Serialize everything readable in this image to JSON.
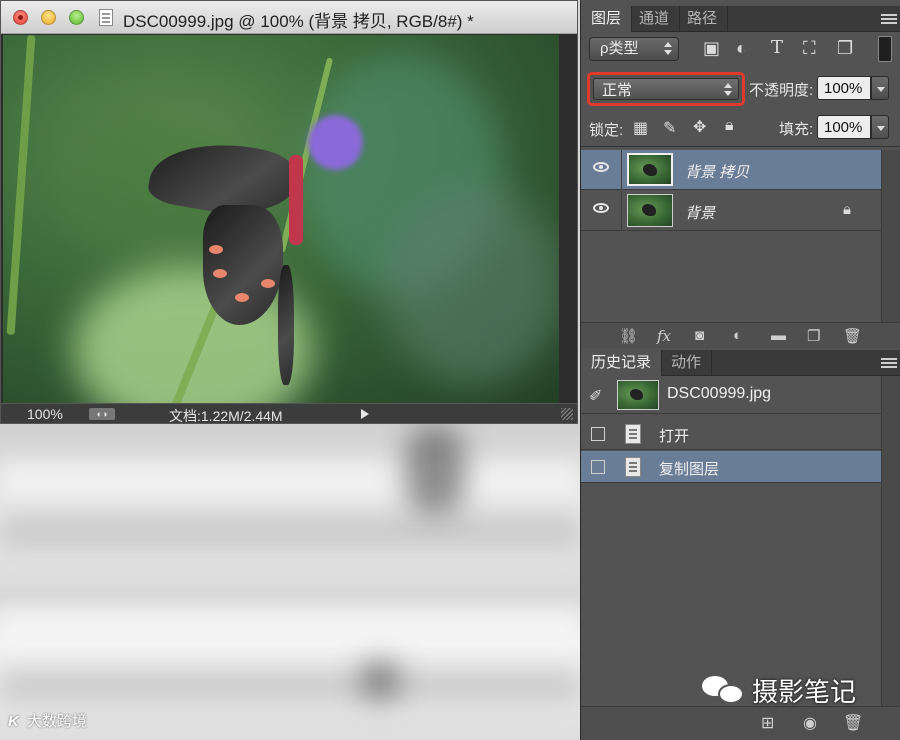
{
  "document": {
    "title": "DSC00999.jpg @ 100% (背景 拷贝, RGB/8#) *",
    "zoom": "100%",
    "status_icon": "◐◑",
    "doc_size": "文档:1.22M/2.44M"
  },
  "layers_panel": {
    "tabs": [
      "图层",
      "通道",
      "路径"
    ],
    "filter_label": "ρ类型",
    "blend_mode": "正常",
    "opacity_label": "不透明度:",
    "opacity_value": "100%",
    "lock_label": "锁定:",
    "fill_label": "填充:",
    "fill_value": "100%",
    "layers": [
      {
        "name": "背景 拷贝",
        "selected": true,
        "locked": false
      },
      {
        "name": "背景",
        "selected": false,
        "locked": true
      }
    ],
    "footer_icons": [
      "link-icon",
      "fx-icon",
      "mask-icon",
      "adjustment-icon",
      "folder-icon",
      "new-layer-icon",
      "trash-icon"
    ],
    "fx_label": "fx"
  },
  "history_panel": {
    "tabs": [
      "历史记录",
      "动作"
    ],
    "snapshot": "DSC00999.jpg",
    "items": [
      {
        "name": "打开",
        "selected": false
      },
      {
        "name": "复制图层",
        "selected": true
      }
    ]
  },
  "watermarks": {
    "right": "摄影笔记",
    "left_logo": "K",
    "left_text": "大数跨境"
  },
  "colors": {
    "highlight_box": "#e03a2c",
    "selection": "#6a7d97",
    "panel_bg": "#535353"
  }
}
